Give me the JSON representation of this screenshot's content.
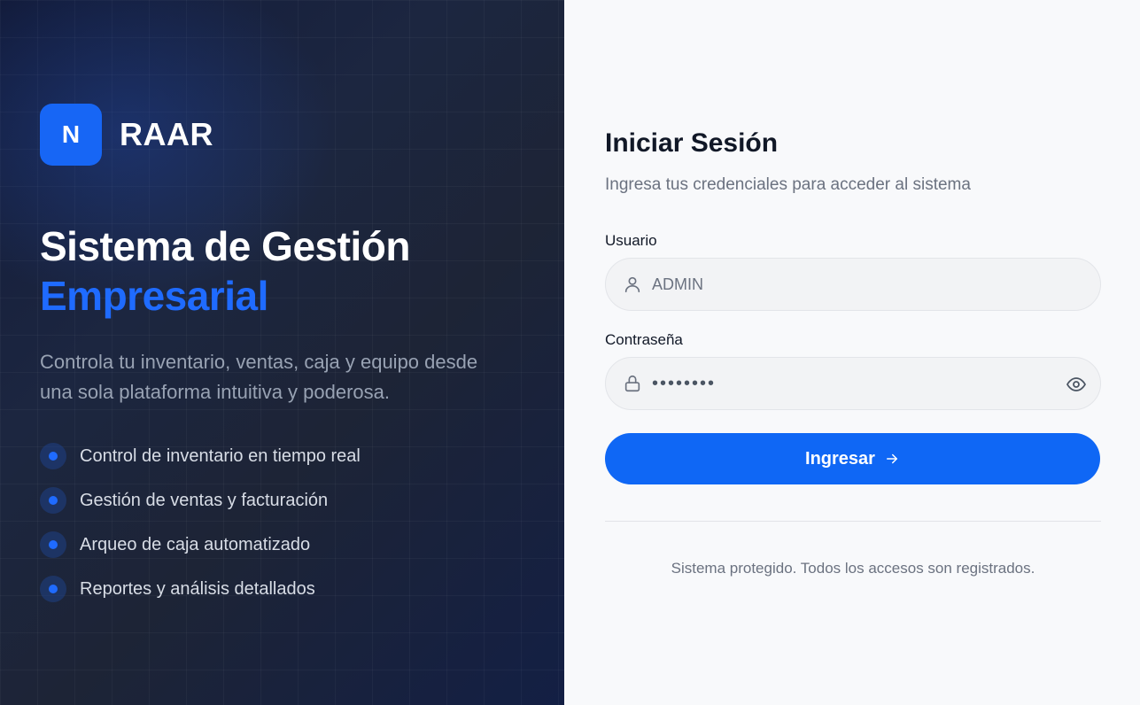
{
  "brand": {
    "logo_letter": "N",
    "name": "RAAR"
  },
  "hero": {
    "title_line1": "Sistema de Gestión",
    "title_line2": "Empresarial",
    "description": "Controla tu inventario, ventas, caja y equipo desde una sola plataforma intuitiva y poderosa."
  },
  "features": [
    {
      "label": "Control de inventario en tiempo real"
    },
    {
      "label": "Gestión de ventas y facturación"
    },
    {
      "label": "Arqueo de caja automatizado"
    },
    {
      "label": "Reportes y análisis detallados"
    }
  ],
  "login": {
    "title": "Iniciar Sesión",
    "subtitle": "Ingresa tus credenciales para acceder al sistema",
    "username": {
      "label": "Usuario",
      "value": "ADMIN",
      "icon": "user-icon"
    },
    "password": {
      "label": "Contraseña",
      "value": "••••••••",
      "icon": "lock-icon",
      "toggle_icon": "eye-icon"
    },
    "submit_label": "Ingresar",
    "submit_icon": "arrow-right-icon",
    "footer_note": "Sistema protegido. Todos los accesos son registrados."
  },
  "colors": {
    "accent": "#1766f5",
    "left_bg": "#1c2640",
    "right_bg": "#f8f9fb"
  }
}
